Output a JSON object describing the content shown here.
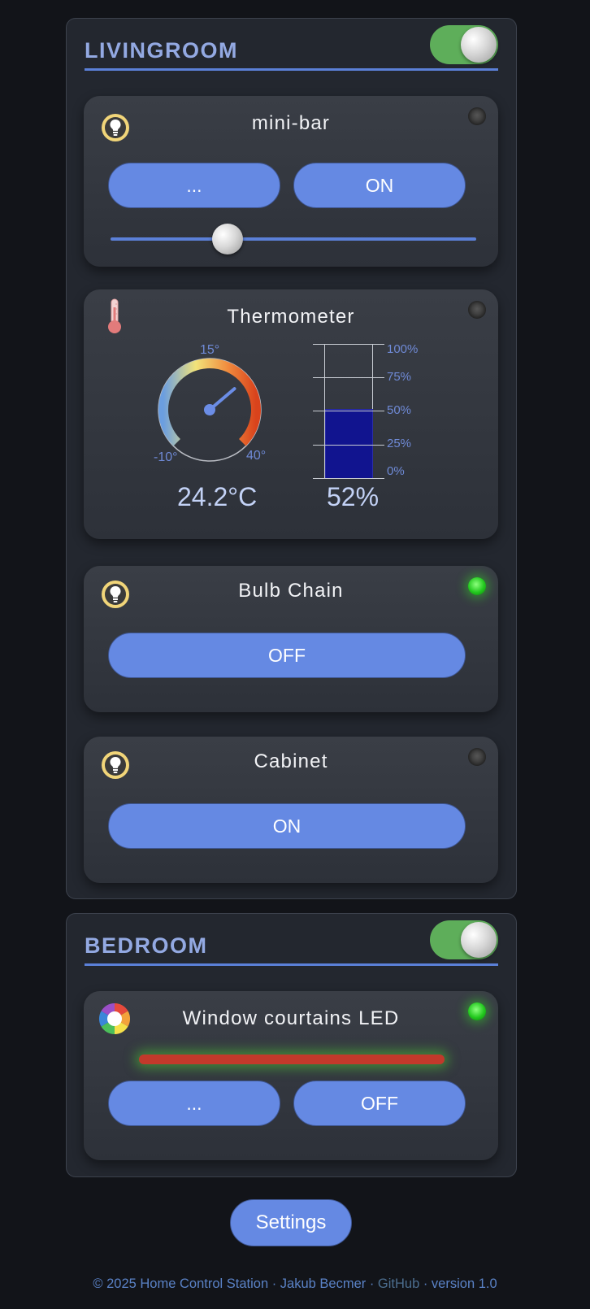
{
  "rooms": {
    "livingroom": {
      "title": "LIVINGROOM",
      "devices": {
        "minibar": {
          "name": "mini-bar",
          "btn_more": "...",
          "btn_power": "ON",
          "slider_value": 0.32
        },
        "thermometer": {
          "name": "Thermometer",
          "gauge": {
            "min_label": "-10°",
            "mid_label": "15°",
            "max_label": "40°",
            "min": -10,
            "max": 40,
            "value": 24.2
          },
          "temperature": "24.2°C",
          "humidity_scale": [
            "100%",
            "75%",
            "50%",
            "25%",
            "0%"
          ],
          "humidity_value": 52,
          "humidity": "52%"
        },
        "bulbchain": {
          "name": "Bulb Chain",
          "btn_power": "OFF"
        },
        "cabinet": {
          "name": "Cabinet",
          "btn_power": "ON"
        }
      }
    },
    "bedroom": {
      "title": "BEDROOM",
      "devices": {
        "courtains": {
          "name": "Window courtains LED",
          "btn_more": "...",
          "btn_power": "OFF",
          "color": "#c2392b"
        }
      }
    }
  },
  "settings_label": "Settings",
  "footer": {
    "copyright": "© 2025 Home Control Station · Jakub Becmer · ",
    "github": "GitHub",
    "version": " · version 1.0"
  },
  "colors": {
    "accent": "#6589e3",
    "toggle_on": "#5eae5a",
    "led_on": "#22c81e",
    "title": "#93a9e2"
  }
}
